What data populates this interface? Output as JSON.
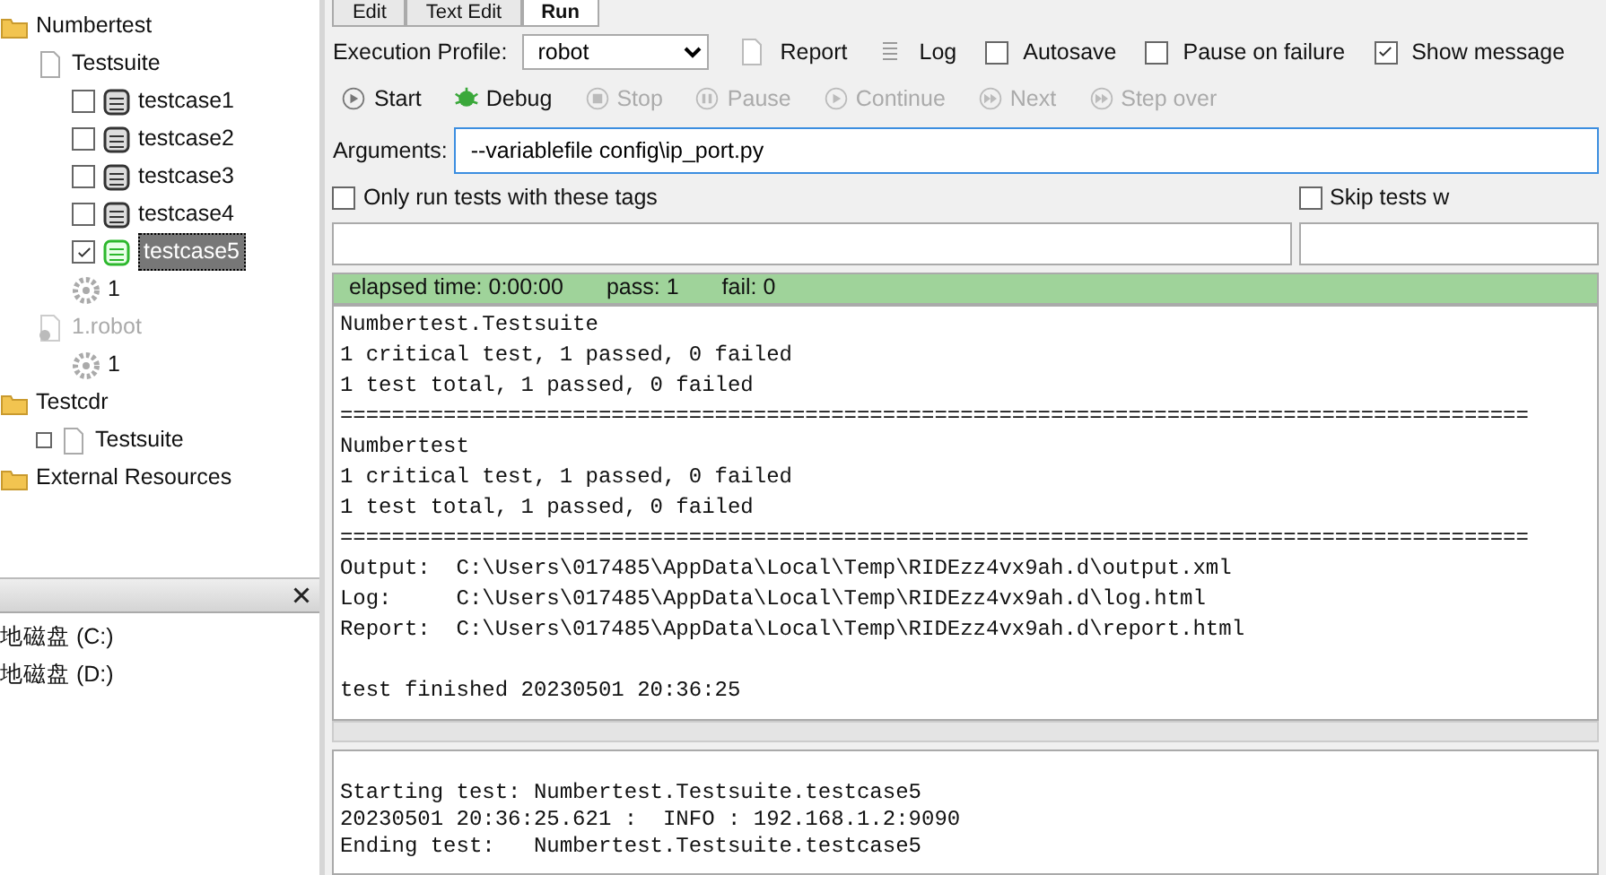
{
  "tree": [
    {
      "label": "Numbertest",
      "kind": "folder",
      "children": [
        {
          "label": "Testsuite",
          "kind": "file",
          "children": [
            {
              "label": "testcase1",
              "kind": "testcase",
              "checked": false,
              "passed": false,
              "selected": false
            },
            {
              "label": "testcase2",
              "kind": "testcase",
              "checked": false,
              "passed": false,
              "selected": false
            },
            {
              "label": "testcase3",
              "kind": "testcase",
              "checked": false,
              "passed": false,
              "selected": false
            },
            {
              "label": "testcase4",
              "kind": "testcase",
              "checked": false,
              "passed": false,
              "selected": false
            },
            {
              "label": "testcase5",
              "kind": "testcase",
              "checked": true,
              "passed": true,
              "selected": true
            },
            {
              "label": "1",
              "kind": "keyword"
            }
          ]
        },
        {
          "label": "1.robot",
          "kind": "resource",
          "disabled": true,
          "children": [
            {
              "label": "1",
              "kind": "keyword"
            }
          ]
        }
      ]
    },
    {
      "label": "Testcdr",
      "kind": "folder",
      "children": [
        {
          "label": "Testsuite",
          "kind": "file",
          "expanded": false
        }
      ]
    },
    {
      "label": "External Resources",
      "kind": "folder"
    }
  ],
  "drives": [
    "地磁盘 (C:)",
    "地磁盘 (D:)"
  ],
  "tabs": [
    {
      "label": "Edit",
      "selected": false
    },
    {
      "label": "Text Edit",
      "selected": false
    },
    {
      "label": "Run",
      "selected": true
    }
  ],
  "profile": {
    "label": "Execution Profile:",
    "value": "robot"
  },
  "toolbar": [
    {
      "label": "Report",
      "kind": "file"
    },
    {
      "label": "Log",
      "kind": "log"
    },
    {
      "label": "Autosave",
      "kind": "check",
      "checked": false
    },
    {
      "label": "Pause on failure",
      "kind": "check",
      "checked": false
    },
    {
      "label": "Show message",
      "kind": "check",
      "checked": true
    }
  ],
  "run_buttons": [
    {
      "label": "Start",
      "disabled": false,
      "kind": "play"
    },
    {
      "label": "Debug",
      "disabled": false,
      "kind": "bug"
    },
    {
      "label": "Stop",
      "disabled": true,
      "kind": "stop"
    },
    {
      "label": "Pause",
      "disabled": true,
      "kind": "pause"
    },
    {
      "label": "Continue",
      "disabled": true,
      "kind": "play"
    },
    {
      "label": "Next",
      "disabled": true,
      "kind": "next"
    },
    {
      "label": "Step over",
      "disabled": true,
      "kind": "next"
    }
  ],
  "arguments": {
    "label": "Arguments:",
    "value": "--variablefile config\\ip_port.py"
  },
  "tag_filters": [
    {
      "label": "Only run tests with these tags",
      "checked": false
    },
    {
      "label": "Skip tests w",
      "checked": false
    }
  ],
  "status_bar": [
    "elapsed time: 0:00:00",
    "pass: 1",
    "fail: 0"
  ],
  "output": [
    "Numbertest.Testsuite",
    "1 critical test, 1 passed, 0 failed",
    "1 test total, 1 passed, 0 failed",
    "============================================================================================",
    "Numbertest",
    "1 critical test, 1 passed, 0 failed",
    "1 test total, 1 passed, 0 failed",
    "============================================================================================",
    "Output:  C:\\Users\\017485\\AppData\\Local\\Temp\\RIDEzz4vx9ah.d\\output.xml",
    "Log:     C:\\Users\\017485\\AppData\\Local\\Temp\\RIDEzz4vx9ah.d\\log.html",
    "Report:  C:\\Users\\017485\\AppData\\Local\\Temp\\RIDEzz4vx9ah.d\\report.html",
    {
      "text": "test finished 20230501 20:36:25",
      "space_before": true
    }
  ],
  "log": [
    "Starting test: Numbertest.Testsuite.testcase5",
    "20230501 20:36:25.621 :  INFO : 192.168.1.2:9090",
    "Ending test:   Numbertest.Testsuite.testcase5"
  ]
}
